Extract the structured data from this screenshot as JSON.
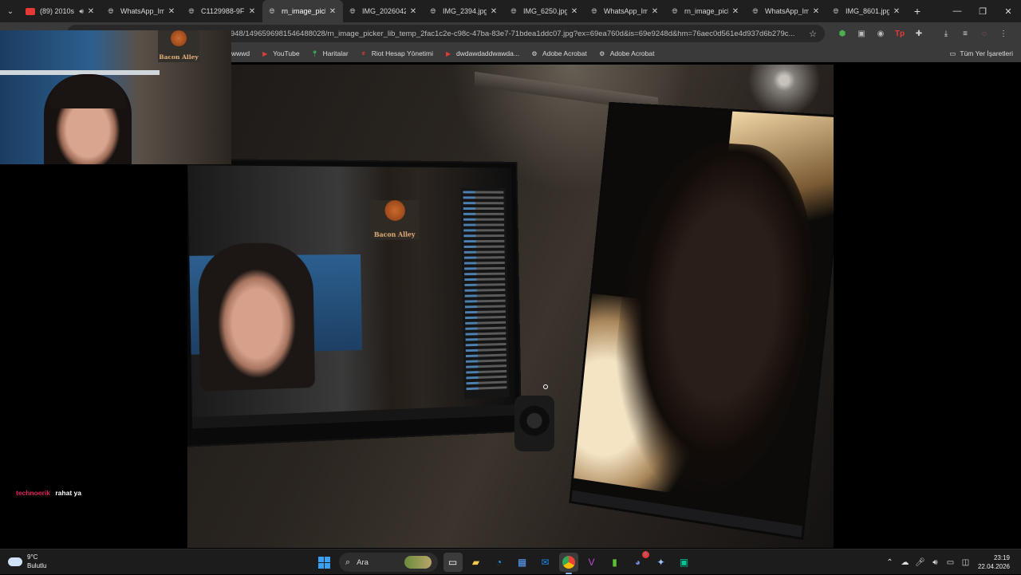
{
  "browser": {
    "tabs": [
      {
        "title": "(89) 2010s",
        "favicon": "youtube-icon",
        "active": false,
        "audio": true
      },
      {
        "title": "WhatsApp_Ima",
        "favicon": "globe-icon",
        "active": false
      },
      {
        "title": "C1129988-9FB",
        "favicon": "globe-icon",
        "active": false
      },
      {
        "title": "rn_image_picke",
        "favicon": "globe-icon",
        "active": true
      },
      {
        "title": "IMG_20260422",
        "favicon": "globe-icon",
        "active": false
      },
      {
        "title": "IMG_2394.jpg",
        "favicon": "globe-icon",
        "active": false
      },
      {
        "title": "IMG_6250.jpg",
        "favicon": "globe-icon",
        "active": false
      },
      {
        "title": "WhatsApp_Ima",
        "favicon": "globe-icon",
        "active": false
      },
      {
        "title": "rn_image_picke",
        "favicon": "globe-icon",
        "active": false
      },
      {
        "title": "WhatsApp_Ima",
        "favicon": "globe-icon",
        "active": false
      },
      {
        "title": "IMG_8601.jpg",
        "favicon": "globe-icon",
        "active": false
      }
    ],
    "new_tab": "+",
    "window_controls": {
      "minimize": "—",
      "restore": "❐",
      "close": "✕"
    },
    "address": {
      "url": "cdn.discordapp.com/attachments/1496596958948/1496596981546488028/rn_image_picker_lib_temp_2fac1c2e-c98c-47ba-83e7-71bdea1ddc07.jpg?ex=69ea760d&is=69e9248d&hm=76aec0d561e4d937d6b279c..."
    },
    "bookmarks": [
      {
        "label": "wwwd",
        "icon": "globe-icon"
      },
      {
        "label": "YouTube",
        "icon": "youtube-icon"
      },
      {
        "label": "Haritalar",
        "icon": "maps-pin-icon"
      },
      {
        "label": "Riot Hesap Yönetimi",
        "icon": "riot-icon"
      },
      {
        "label": "dwdawdaddwawda...",
        "icon": "youtube-icon"
      },
      {
        "label": "Adobe Acrobat",
        "icon": "acrobat-icon"
      },
      {
        "label": "Adobe Acrobat",
        "icon": "acrobat-icon"
      }
    ],
    "all_bookmarks": "Tüm Yer İşaretleri"
  },
  "photo": {
    "left_monitor_logo_text": "Bacon Alley",
    "webcam_logo_text": "Bacon Alley"
  },
  "stream_chat": {
    "user": "technoerik",
    "message": "rahat ya",
    "user_color": "#e0245e"
  },
  "taskbar": {
    "weather_temp": "9°C",
    "weather_desc": "Bulutlu",
    "search_label": "Ara",
    "clock_time": "23:19",
    "clock_date": "22.04.2026",
    "discord_badge": "9"
  }
}
